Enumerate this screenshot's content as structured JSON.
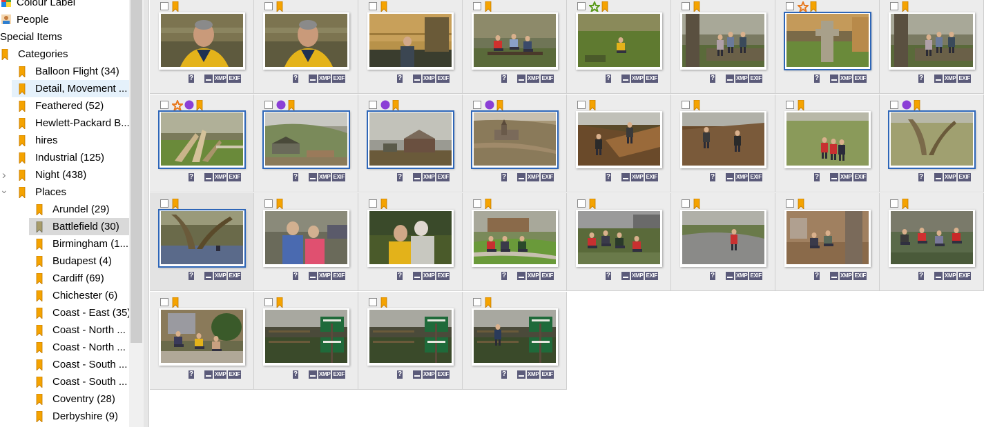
{
  "sidebar": {
    "items": [
      {
        "label": "Colour Label",
        "icon": "colour-label-icon"
      },
      {
        "label": "People",
        "icon": "people-icon"
      },
      {
        "label": "Special Items",
        "icon": ""
      },
      {
        "label": "Categories",
        "icon": "bookmark-icon"
      },
      {
        "label": "Balloon Flight (34)",
        "icon": "bookmark-icon"
      },
      {
        "label": "Detail, Movement ...",
        "icon": "bookmark-icon"
      },
      {
        "label": "Feathered (52)",
        "icon": "bookmark-icon"
      },
      {
        "label": "Hewlett-Packard B...",
        "icon": "bookmark-icon"
      },
      {
        "label": "hires",
        "icon": "bookmark-icon"
      },
      {
        "label": "Industrial (125)",
        "icon": "bookmark-icon"
      },
      {
        "label": "Night (438)",
        "icon": "bookmark-icon"
      },
      {
        "label": "Places",
        "icon": "bookmark-icon"
      },
      {
        "label": "Arundel (29)",
        "icon": "bookmark-icon"
      },
      {
        "label": "Battlefield (30)",
        "icon": "bookmark-icon"
      },
      {
        "label": "Birmingham (1...",
        "icon": "bookmark-icon"
      },
      {
        "label": "Budapest (4)",
        "icon": "bookmark-icon"
      },
      {
        "label": "Cardiff (69)",
        "icon": "bookmark-icon"
      },
      {
        "label": "Chichester (6)",
        "icon": "bookmark-icon"
      },
      {
        "label": "Coast - East (35)",
        "icon": "bookmark-icon"
      },
      {
        "label": "Coast - North ...",
        "icon": "bookmark-icon"
      },
      {
        "label": "Coast - North ...",
        "icon": "bookmark-icon"
      },
      {
        "label": "Coast - South ...",
        "icon": "bookmark-icon"
      },
      {
        "label": "Coast - South ...",
        "icon": "bookmark-icon"
      },
      {
        "label": "Coventry (28)",
        "icon": "bookmark-icon"
      },
      {
        "label": "Derbyshire (9)",
        "icon": "bookmark-icon"
      }
    ]
  },
  "badges": {
    "q": "?",
    "xmp": "XMP",
    "exif": "EXIF"
  },
  "colors": {
    "bookmark": "#f5a300",
    "purple": "#8b3fd6",
    "star_orange": "#e8791f",
    "star_green": "#5a9a1a",
    "frame_blue": "#2e66b8"
  },
  "thumbnails": [
    {
      "scene": "portrait-yellow",
      "flags": []
    },
    {
      "scene": "portrait-yellow",
      "flags": []
    },
    {
      "scene": "stone-wall-person",
      "flags": []
    },
    {
      "scene": "bench-group",
      "flags": []
    },
    {
      "scene": "sitting-grass",
      "flags": [
        "star-green"
      ]
    },
    {
      "scene": "tree-wall-group",
      "flags": []
    },
    {
      "scene": "cross-monument",
      "flags": [
        "star-orange",
        "blue"
      ]
    },
    {
      "scene": "tree-wall-group",
      "flags": []
    },
    {
      "scene": "fallen-branches",
      "flags": [
        "star-orange",
        "purple",
        "blue"
      ]
    },
    {
      "scene": "hillside-barn",
      "flags": [
        "purple",
        "blue"
      ]
    },
    {
      "scene": "farm-buildings",
      "flags": [
        "purple",
        "blue"
      ]
    },
    {
      "scene": "church-village",
      "flags": [
        "purple",
        "blue"
      ]
    },
    {
      "scene": "bank-walkers",
      "flags": []
    },
    {
      "scene": "bank-walkers-2",
      "flags": []
    },
    {
      "scene": "field-walkers",
      "flags": []
    },
    {
      "scene": "willow-field",
      "flags": [
        "purple",
        "blue"
      ]
    },
    {
      "scene": "willow-pond",
      "flags": [
        "blue",
        "selected"
      ]
    },
    {
      "scene": "map-reading",
      "flags": []
    },
    {
      "scene": "two-walkers",
      "flags": []
    },
    {
      "scene": "village-green",
      "flags": []
    },
    {
      "scene": "resting-group",
      "flags": []
    },
    {
      "scene": "road-walker",
      "flags": []
    },
    {
      "scene": "house-group",
      "flags": []
    },
    {
      "scene": "bench-map",
      "flags": []
    },
    {
      "scene": "bush-gathering",
      "flags": []
    },
    {
      "scene": "footpath-sign",
      "flags": []
    },
    {
      "scene": "footpath-sign",
      "flags": []
    },
    {
      "scene": "footpath-sign-walker",
      "flags": []
    }
  ]
}
